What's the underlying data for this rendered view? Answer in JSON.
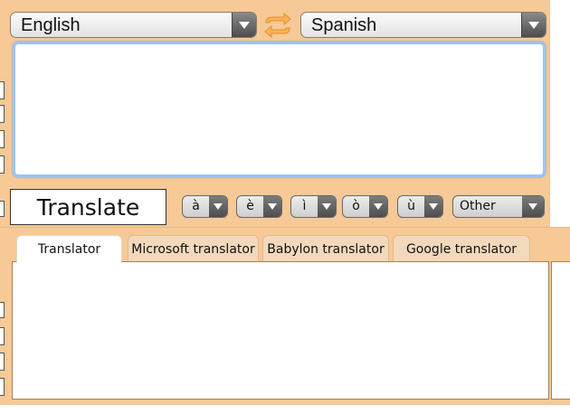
{
  "source_language": {
    "selected": "English"
  },
  "target_language": {
    "selected": "Spanish"
  },
  "swap_icon": "swap-arrows-icon",
  "input": {
    "value": ""
  },
  "translate_button": {
    "label": "Translate"
  },
  "accent_buttons": [
    {
      "label": "à"
    },
    {
      "label": "è"
    },
    {
      "label": "ì"
    },
    {
      "label": "ò"
    },
    {
      "label": "ù"
    }
  ],
  "other_button": {
    "label": "Other"
  },
  "tabs": [
    {
      "label": "Translator",
      "active": true
    },
    {
      "label": "Microsoft translator",
      "active": false
    },
    {
      "label": "Babylon translator",
      "active": false
    },
    {
      "label": "Google translator",
      "active": false
    }
  ],
  "colors": {
    "background": "#f6c996",
    "textarea_focus_border": "#9cc3f1",
    "tab_inactive": "#f3d9bb",
    "swap_icon": "#f3a53a"
  }
}
